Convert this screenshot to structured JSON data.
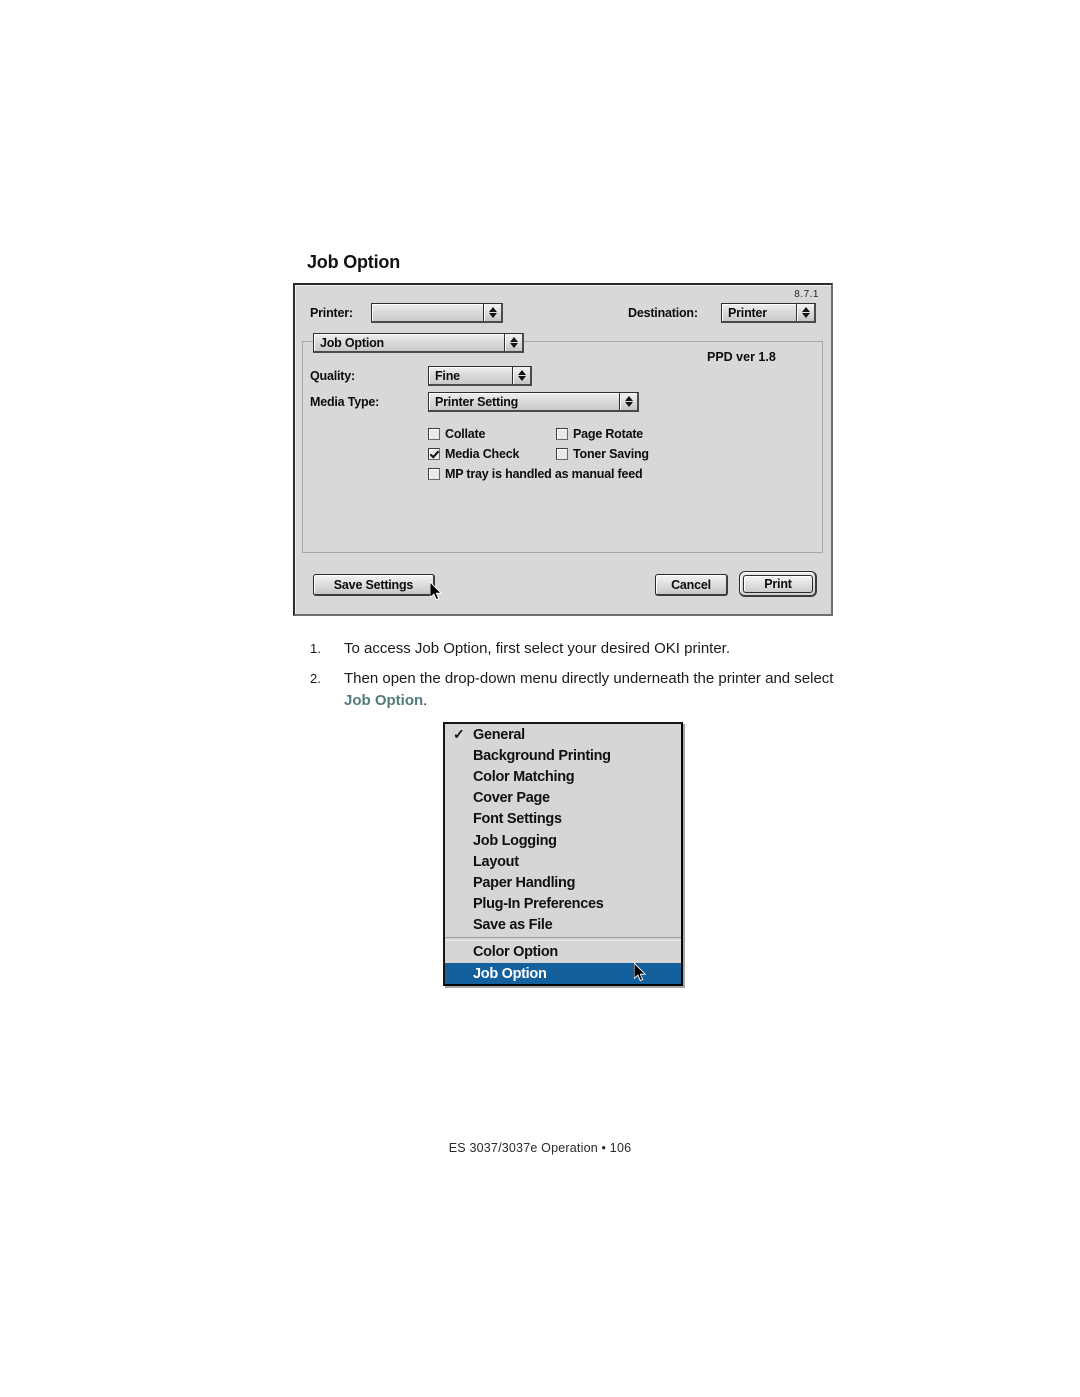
{
  "page": {
    "heading": "Job Option",
    "footer": "ES 3037/3037e  Operation • 106"
  },
  "dialog": {
    "version": "8.7.1",
    "printer_label": "Printer:",
    "printer_value": "",
    "destination_label": "Destination:",
    "destination_value": "Printer",
    "pane_value": "Job Option",
    "ppd_version": "PPD ver 1.8",
    "quality_label": "Quality:",
    "quality_value": "Fine",
    "media_label": "Media Type:",
    "media_value": "Printer Setting",
    "checkboxes": [
      {
        "label": "Collate",
        "checked": false
      },
      {
        "label": "Page Rotate",
        "checked": false
      },
      {
        "label": "Media Check",
        "checked": true
      },
      {
        "label": "Toner Saving",
        "checked": false
      },
      {
        "label": "MP tray is handled as manual feed",
        "checked": false
      }
    ],
    "buttons": {
      "save": "Save Settings",
      "cancel": "Cancel",
      "print": "Print"
    }
  },
  "instructions": [
    {
      "number": "1.",
      "text_before": "To access Job Option, first select your desired OKI printer.",
      "highlight": "",
      "text_after": ""
    },
    {
      "number": "2.",
      "text_before": "Then open the drop-down menu directly underneath the printer and select ",
      "highlight": "Job Option",
      "text_after": "."
    }
  ],
  "popup_menu": {
    "items": [
      {
        "label": "General",
        "checked": true,
        "selected": false,
        "separator_before": false
      },
      {
        "label": "Background Printing",
        "checked": false,
        "selected": false,
        "separator_before": false
      },
      {
        "label": "Color Matching",
        "checked": false,
        "selected": false,
        "separator_before": false
      },
      {
        "label": "Cover Page",
        "checked": false,
        "selected": false,
        "separator_before": false
      },
      {
        "label": "Font Settings",
        "checked": false,
        "selected": false,
        "separator_before": false
      },
      {
        "label": "Job Logging",
        "checked": false,
        "selected": false,
        "separator_before": false
      },
      {
        "label": "Layout",
        "checked": false,
        "selected": false,
        "separator_before": false
      },
      {
        "label": "Paper Handling",
        "checked": false,
        "selected": false,
        "separator_before": false
      },
      {
        "label": "Plug-In Preferences",
        "checked": false,
        "selected": false,
        "separator_before": false
      },
      {
        "label": "Save as File",
        "checked": false,
        "selected": false,
        "separator_before": false
      },
      {
        "label": "Color Option",
        "checked": false,
        "selected": false,
        "separator_before": true
      },
      {
        "label": "Job Option",
        "checked": false,
        "selected": true,
        "separator_before": false
      }
    ]
  },
  "colors": {
    "menu_highlight": "#14609c",
    "inline_highlight": "#4f7b79",
    "dialog_face": "#d8d8d8"
  }
}
